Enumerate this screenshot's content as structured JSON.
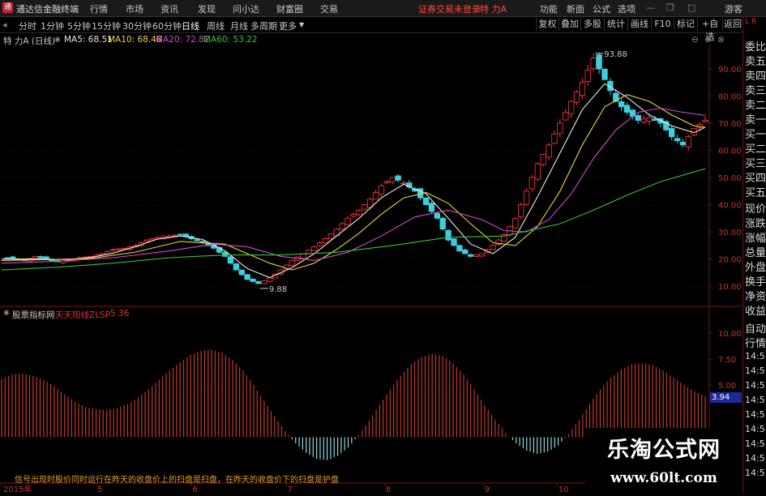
{
  "app": {
    "title": "通达信金融终端",
    "menu": [
      "行情",
      "市场",
      "资讯",
      "发现",
      "问小达",
      "财富圈",
      "交易"
    ],
    "notice": "证券交易未登录",
    "stock_title": "特 力A",
    "right_menu": [
      "功能",
      "新面",
      "公式",
      "选项"
    ],
    "guest": "游客"
  },
  "toolbar": {
    "periods": [
      "分时",
      "1分钟",
      "5分钟",
      "15分钟",
      "30分钟",
      "60分钟",
      "日线",
      "周线",
      "月线",
      "多周期",
      "更多"
    ],
    "active_period": "日线",
    "right_buttons": [
      "复权",
      "叠加",
      "多股",
      "统计",
      "画线",
      "F10",
      "标记",
      "+自选",
      "返回"
    ]
  },
  "main_chart": {
    "stock_label": "特 力A (日线)",
    "indicators": [
      {
        "label": "MA5: 68.51",
        "color": "#e8e8e8"
      },
      {
        "label": "MA10: 68.48",
        "color": "#e8d43a"
      },
      {
        "label": "MA20: 72.82",
        "color": "#d04ad0"
      },
      {
        "label": "MA60: 53.22",
        "color": "#39c239"
      }
    ],
    "high_label": "93.88",
    "low_label": "9.88"
  },
  "sub_chart": {
    "source_label": "股票指标网",
    "indicator_label": "天天阳线ZLSP",
    "indicator_value": "5.36",
    "current_value": "3.94",
    "bottom_text": "信号出现时股价同时运行在昨天的收盘价上的扫盘是扫盘，在昨天的收盘价下的扫盘是护盘"
  },
  "chart_data": [
    {
      "type": "line",
      "title": "特 力A (日线)",
      "x": [
        "2015年",
        "5",
        "6",
        "7",
        "8",
        "9",
        "10"
      ],
      "y_ticks": [
        "90.00",
        "80.00",
        "70.00",
        "60.00",
        "50.00",
        "40.00",
        "30.00",
        "20.00",
        "10.00"
      ],
      "ylim": [
        5,
        98
      ],
      "close_points": [
        [
          0,
          20.5
        ],
        [
          2,
          20.2
        ],
        [
          4,
          19.5
        ],
        [
          6,
          21.0
        ],
        [
          8,
          19.8
        ],
        [
          10,
          19.0
        ],
        [
          12,
          19.5
        ],
        [
          14,
          20.5
        ],
        [
          16,
          21.0
        ],
        [
          18,
          22.0
        ],
        [
          20,
          23.5
        ],
        [
          22,
          24.0
        ],
        [
          24,
          25.0
        ],
        [
          26,
          27.0
        ],
        [
          28,
          28.0
        ],
        [
          30,
          28.5
        ],
        [
          32,
          29.0
        ],
        [
          34,
          27.5
        ],
        [
          36,
          26.0
        ],
        [
          38,
          24.0
        ],
        [
          40,
          21.0
        ],
        [
          42,
          16.0
        ],
        [
          44,
          12.5
        ],
        [
          46,
          11.0
        ],
        [
          48,
          13.0
        ],
        [
          50,
          16.0
        ],
        [
          52,
          19.5
        ],
        [
          54,
          22.0
        ],
        [
          56,
          24.5
        ],
        [
          58,
          27.5
        ],
        [
          60,
          31.0
        ],
        [
          62,
          35.0
        ],
        [
          64,
          38.0
        ],
        [
          66,
          42.0
        ],
        [
          68,
          47.0
        ],
        [
          70,
          50.0
        ],
        [
          72,
          48.0
        ],
        [
          74,
          45.0
        ],
        [
          76,
          40.0
        ],
        [
          78,
          35.0
        ],
        [
          80,
          27.0
        ],
        [
          82,
          23.0
        ],
        [
          84,
          21.0
        ],
        [
          86,
          22.0
        ],
        [
          88,
          25.0
        ],
        [
          90,
          29.0
        ],
        [
          92,
          35.0
        ],
        [
          94,
          45.0
        ],
        [
          96,
          55.0
        ],
        [
          98,
          62.0
        ],
        [
          100,
          70.0
        ],
        [
          102,
          78.0
        ],
        [
          104,
          85.0
        ],
        [
          106,
          93.88
        ],
        [
          108,
          86.0
        ],
        [
          110,
          78.0
        ],
        [
          112,
          74.0
        ],
        [
          114,
          71.0
        ],
        [
          116,
          72.0
        ],
        [
          118,
          70.0
        ],
        [
          120,
          65.0
        ],
        [
          122,
          62.0
        ],
        [
          124,
          68.0
        ],
        [
          126,
          71.0
        ]
      ],
      "series": [
        {
          "name": "MA5",
          "color": "#e8e8e8",
          "values": [
            [
              0,
              20.0
            ],
            [
              4,
              20.0
            ],
            [
              8,
              20.0
            ],
            [
              12,
              19.8
            ],
            [
              16,
              20.6
            ],
            [
              20,
              22.2
            ],
            [
              24,
              24.6
            ],
            [
              28,
              27.4
            ],
            [
              32,
              28.5
            ],
            [
              36,
              27.2
            ],
            [
              40,
              23.0
            ],
            [
              44,
              16.5
            ],
            [
              48,
              13.2
            ],
            [
              52,
              16.8
            ],
            [
              56,
              22.0
            ],
            [
              60,
              28.5
            ],
            [
              64,
              35.0
            ],
            [
              68,
              42.5
            ],
            [
              72,
              47.5
            ],
            [
              76,
              44.0
            ],
            [
              80,
              35.0
            ],
            [
              84,
              25.5
            ],
            [
              88,
              22.0
            ],
            [
              92,
              28.0
            ],
            [
              96,
              43.0
            ],
            [
              100,
              59.0
            ],
            [
              104,
              75.0
            ],
            [
              108,
              84.5
            ],
            [
              112,
              79.5
            ],
            [
              116,
              73.0
            ],
            [
              120,
              69.0
            ],
            [
              124,
              66.5
            ],
            [
              126,
              68.5
            ]
          ]
        },
        {
          "name": "MA10",
          "color": "#e8d43a",
          "values": [
            [
              0,
              19.5
            ],
            [
              8,
              19.8
            ],
            [
              16,
              20.2
            ],
            [
              24,
              22.6
            ],
            [
              32,
              26.5
            ],
            [
              40,
              25.5
            ],
            [
              44,
              22.0
            ],
            [
              48,
              18.5
            ],
            [
              52,
              16.0
            ],
            [
              56,
              18.5
            ],
            [
              60,
              23.5
            ],
            [
              64,
              29.5
            ],
            [
              68,
              36.5
            ],
            [
              72,
              42.5
            ],
            [
              76,
              44.5
            ],
            [
              80,
              40.5
            ],
            [
              84,
              33.0
            ],
            [
              88,
              26.0
            ],
            [
              92,
              25.0
            ],
            [
              96,
              32.0
            ],
            [
              100,
              45.0
            ],
            [
              104,
              62.0
            ],
            [
              108,
              76.0
            ],
            [
              112,
              80.5
            ],
            [
              116,
              78.0
            ],
            [
              120,
              73.0
            ],
            [
              124,
              69.0
            ],
            [
              126,
              68.5
            ]
          ]
        },
        {
          "name": "MA20",
          "color": "#d04ad0",
          "values": [
            [
              0,
              18.5
            ],
            [
              10,
              19.2
            ],
            [
              20,
              20.5
            ],
            [
              30,
              23.0
            ],
            [
              38,
              25.5
            ],
            [
              44,
              24.5
            ],
            [
              50,
              21.0
            ],
            [
              56,
              19.5
            ],
            [
              62,
              22.5
            ],
            [
              68,
              28.5
            ],
            [
              74,
              35.5
            ],
            [
              80,
              38.0
            ],
            [
              86,
              34.5
            ],
            [
              90,
              30.5
            ],
            [
              94,
              30.0
            ],
            [
              98,
              34.5
            ],
            [
              102,
              44.0
            ],
            [
              106,
              57.0
            ],
            [
              110,
              67.5
            ],
            [
              114,
              74.0
            ],
            [
              118,
              75.5
            ],
            [
              122,
              74.0
            ],
            [
              126,
              72.8
            ]
          ]
        },
        {
          "name": "MA60",
          "color": "#39c239",
          "values": [
            [
              0,
              16.0
            ],
            [
              10,
              17.0
            ],
            [
              20,
              18.5
            ],
            [
              30,
              20.5
            ],
            [
              40,
              21.5
            ],
            [
              50,
              21.5
            ],
            [
              60,
              22.5
            ],
            [
              70,
              25.0
            ],
            [
              80,
              28.0
            ],
            [
              90,
              28.5
            ],
            [
              100,
              33.0
            ],
            [
              106,
              38.0
            ],
            [
              112,
              43.5
            ],
            [
              118,
              48.5
            ],
            [
              126,
              53.22
            ]
          ]
        }
      ]
    },
    {
      "type": "bar",
      "title": "天天阳线ZLSP",
      "y_ticks": [
        "10.00",
        "7.50",
        "5.00"
      ],
      "ylim": [
        -3,
        11
      ],
      "values": [
        5.6,
        6.0,
        6.1,
        5.9,
        5.5,
        4.9,
        4.1,
        3.4,
        2.9,
        2.7,
        2.6,
        2.8,
        3.2,
        3.8,
        4.6,
        5.5,
        6.4,
        7.2,
        7.9,
        8.3,
        8.4,
        8.1,
        7.4,
        6.4,
        5.0,
        3.5,
        2.0,
        0.6,
        -0.6,
        -1.5,
        -2.1,
        -2.2,
        -1.8,
        -1.0,
        0.2,
        1.6,
        3.1,
        4.6,
        5.9,
        7.0,
        7.7,
        8.0,
        7.8,
        7.1,
        6.0,
        4.6,
        3.1,
        1.7,
        0.4,
        -0.6,
        -1.3,
        -1.6,
        -1.4,
        -0.8,
        0.3,
        1.7,
        3.2,
        4.6,
        5.7,
        6.5,
        7.0,
        7.1,
        6.9,
        6.4,
        5.7,
        5.0,
        4.4,
        3.94
      ],
      "current": 3.94
    }
  ]
}
